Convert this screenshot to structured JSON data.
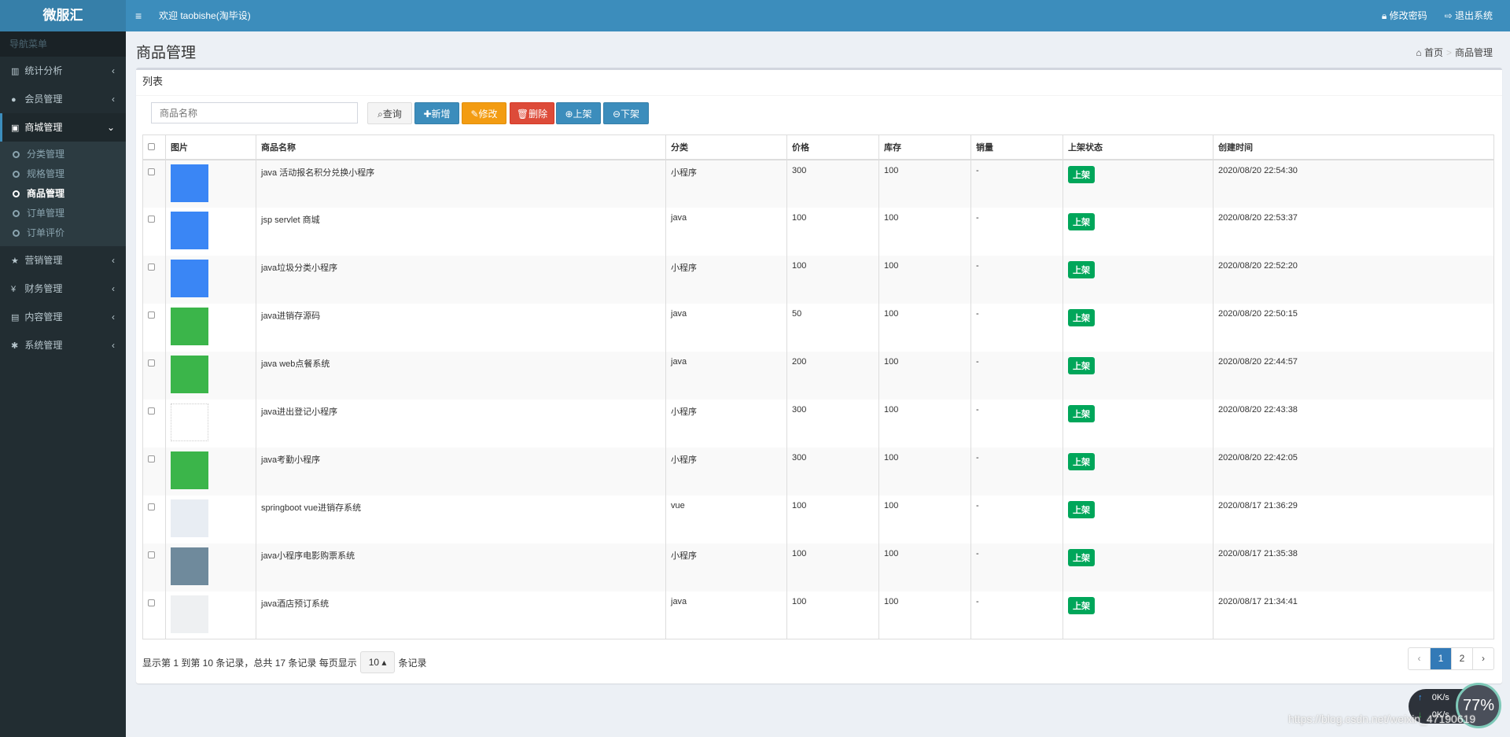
{
  "header": {
    "logo": "微服汇",
    "menu_icon": "≡",
    "welcome": "欢迎 taobishe(淘毕设)",
    "change_password": "修改密码",
    "logout": "退出系统"
  },
  "sidebar": {
    "title": "导航菜单",
    "items": [
      {
        "label": "统计分析",
        "icon": "chart-icon",
        "glyph": "▥"
      },
      {
        "label": "会员管理",
        "icon": "user-icon",
        "glyph": "●"
      },
      {
        "label": "商城管理",
        "icon": "shopping-bag-icon",
        "glyph": "▣",
        "active": true,
        "children": [
          {
            "label": "分类管理"
          },
          {
            "label": "规格管理"
          },
          {
            "label": "商品管理",
            "active": true
          },
          {
            "label": "订单管理"
          },
          {
            "label": "订单评价"
          }
        ]
      },
      {
        "label": "营销管理",
        "icon": "star-icon",
        "glyph": "★"
      },
      {
        "label": "财务管理",
        "icon": "yen-icon",
        "glyph": "¥"
      },
      {
        "label": "内容管理",
        "icon": "file-icon",
        "glyph": "▤"
      },
      {
        "label": "系统管理",
        "icon": "gear-icon",
        "glyph": "✱"
      }
    ]
  },
  "page": {
    "title": "商品管理",
    "breadcrumb": [
      "首页",
      "商品管理"
    ]
  },
  "box": {
    "title": "列表"
  },
  "toolbar": {
    "search_placeholder": "商品名称",
    "query": "查询",
    "add": "新增",
    "edit": "修改",
    "delete": "删除",
    "on_shelf": "上架",
    "off_shelf": "下架"
  },
  "table": {
    "columns": [
      "图片",
      "商品名称",
      "分类",
      "价格",
      "库存",
      "销量",
      "上架状态",
      "创建时间"
    ],
    "rows": [
      {
        "name": "java 活动报名积分兑换小程序",
        "category": "小程序",
        "price": "300",
        "stock": "100",
        "sales": "-",
        "status": "上架",
        "created": "2020/08/20 22:54:30",
        "thumb_color": "#3a86f5"
      },
      {
        "name": "jsp servlet 商城",
        "category": "java",
        "price": "100",
        "stock": "100",
        "sales": "-",
        "status": "上架",
        "created": "2020/08/20 22:53:37",
        "thumb_color": "#3a86f5"
      },
      {
        "name": "java垃圾分类小程序",
        "category": "小程序",
        "price": "100",
        "stock": "100",
        "sales": "-",
        "status": "上架",
        "created": "2020/08/20 22:52:20",
        "thumb_color": "#3a86f5"
      },
      {
        "name": "java进销存源码",
        "category": "java",
        "price": "50",
        "stock": "100",
        "sales": "-",
        "status": "上架",
        "created": "2020/08/20 22:50:15",
        "thumb_color": "#3bb54a"
      },
      {
        "name": "java web点餐系统",
        "category": "java",
        "price": "200",
        "stock": "100",
        "sales": "-",
        "status": "上架",
        "created": "2020/08/20 22:44:57",
        "thumb_color": "#3bb54a"
      },
      {
        "name": "java进出登记小程序",
        "category": "小程序",
        "price": "300",
        "stock": "100",
        "sales": "-",
        "status": "上架",
        "created": "2020/08/20 22:43:38",
        "thumb_color": "#ffffff"
      },
      {
        "name": "java考勤小程序",
        "category": "小程序",
        "price": "300",
        "stock": "100",
        "sales": "-",
        "status": "上架",
        "created": "2020/08/20 22:42:05",
        "thumb_color": "#3bb54a"
      },
      {
        "name": "springboot vue进销存系统",
        "category": "vue",
        "price": "100",
        "stock": "100",
        "sales": "-",
        "status": "上架",
        "created": "2020/08/17 21:36:29",
        "thumb_color": "#e8edf3"
      },
      {
        "name": "java小程序电影购票系统",
        "category": "小程序",
        "price": "100",
        "stock": "100",
        "sales": "-",
        "status": "上架",
        "created": "2020/08/17 21:35:38",
        "thumb_color": "#6f8a9c"
      },
      {
        "name": "java酒店预订系统",
        "category": "java",
        "price": "100",
        "stock": "100",
        "sales": "-",
        "status": "上架",
        "created": "2020/08/17 21:34:41",
        "thumb_color": "#eef0f2"
      }
    ]
  },
  "pagination": {
    "info_prefix": "显示第 1 到第 10 条记录，总共 17 条记录 每页显示",
    "page_size": "10 ▴",
    "info_suffix": "条记录",
    "prev": "‹",
    "pages": [
      "1",
      "2"
    ],
    "current": "1",
    "next": "›"
  },
  "overlay": {
    "upload": "0K/s",
    "download": "0K/s",
    "cpu": "77%",
    "watermark": "https://blog.csdn.net/weixin_47190619"
  }
}
